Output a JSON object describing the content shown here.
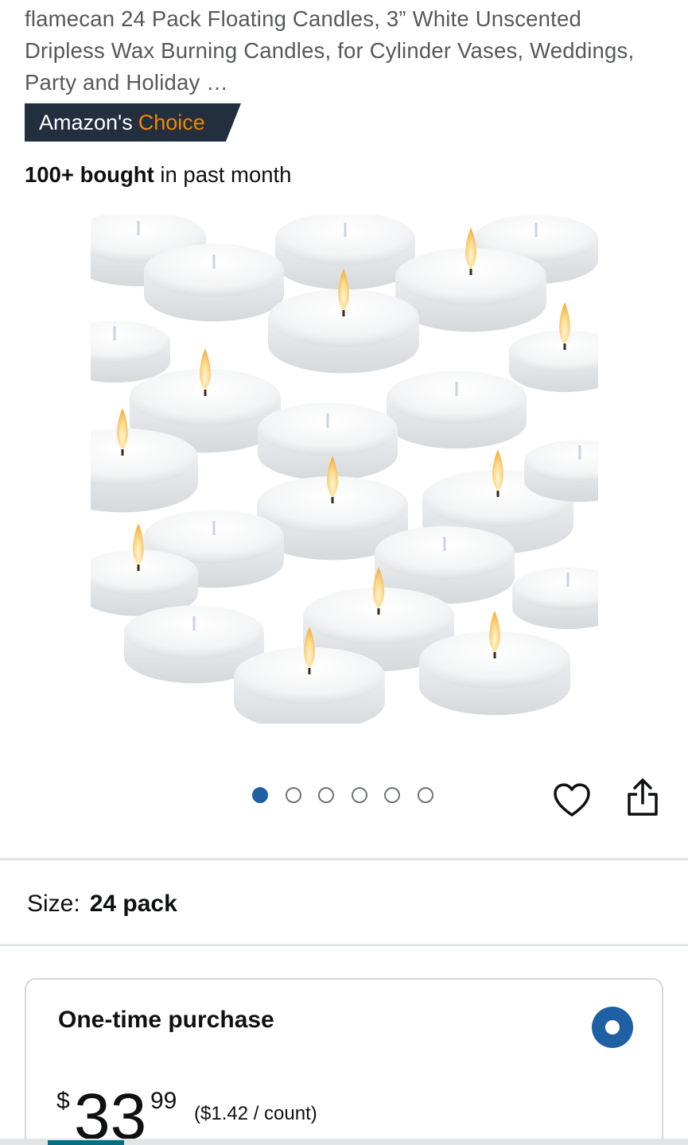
{
  "product": {
    "title": "flamecan 24 Pack Floating Candles, 3” White Unscented Dripless Wax Burning Candles, for Cylinder Vases, Weddings, Party and Holiday …",
    "badge": {
      "prefix": "Amazon's",
      "highlight": "Choice"
    },
    "bought": {
      "count": "100+ bought",
      "suffix": " in past month"
    },
    "image": {
      "description_icon": "floating-candles-photo"
    },
    "carousel": {
      "total": 6,
      "active_index": 0
    }
  },
  "actions": {
    "favorite_icon": "heart-icon",
    "share_icon": "share-icon"
  },
  "size": {
    "label": "Size:",
    "value": "24 pack"
  },
  "purchase": {
    "title": "One-time purchase",
    "selected": true,
    "price": {
      "currency": "$",
      "whole": "33",
      "fraction": "99"
    },
    "unit_price": "($1.42 / count)"
  },
  "colors": {
    "badge_bg": "#232f3e",
    "badge_highlight": "#f08804",
    "accent_blue": "#1f5fa3",
    "text_muted": "#565959"
  }
}
